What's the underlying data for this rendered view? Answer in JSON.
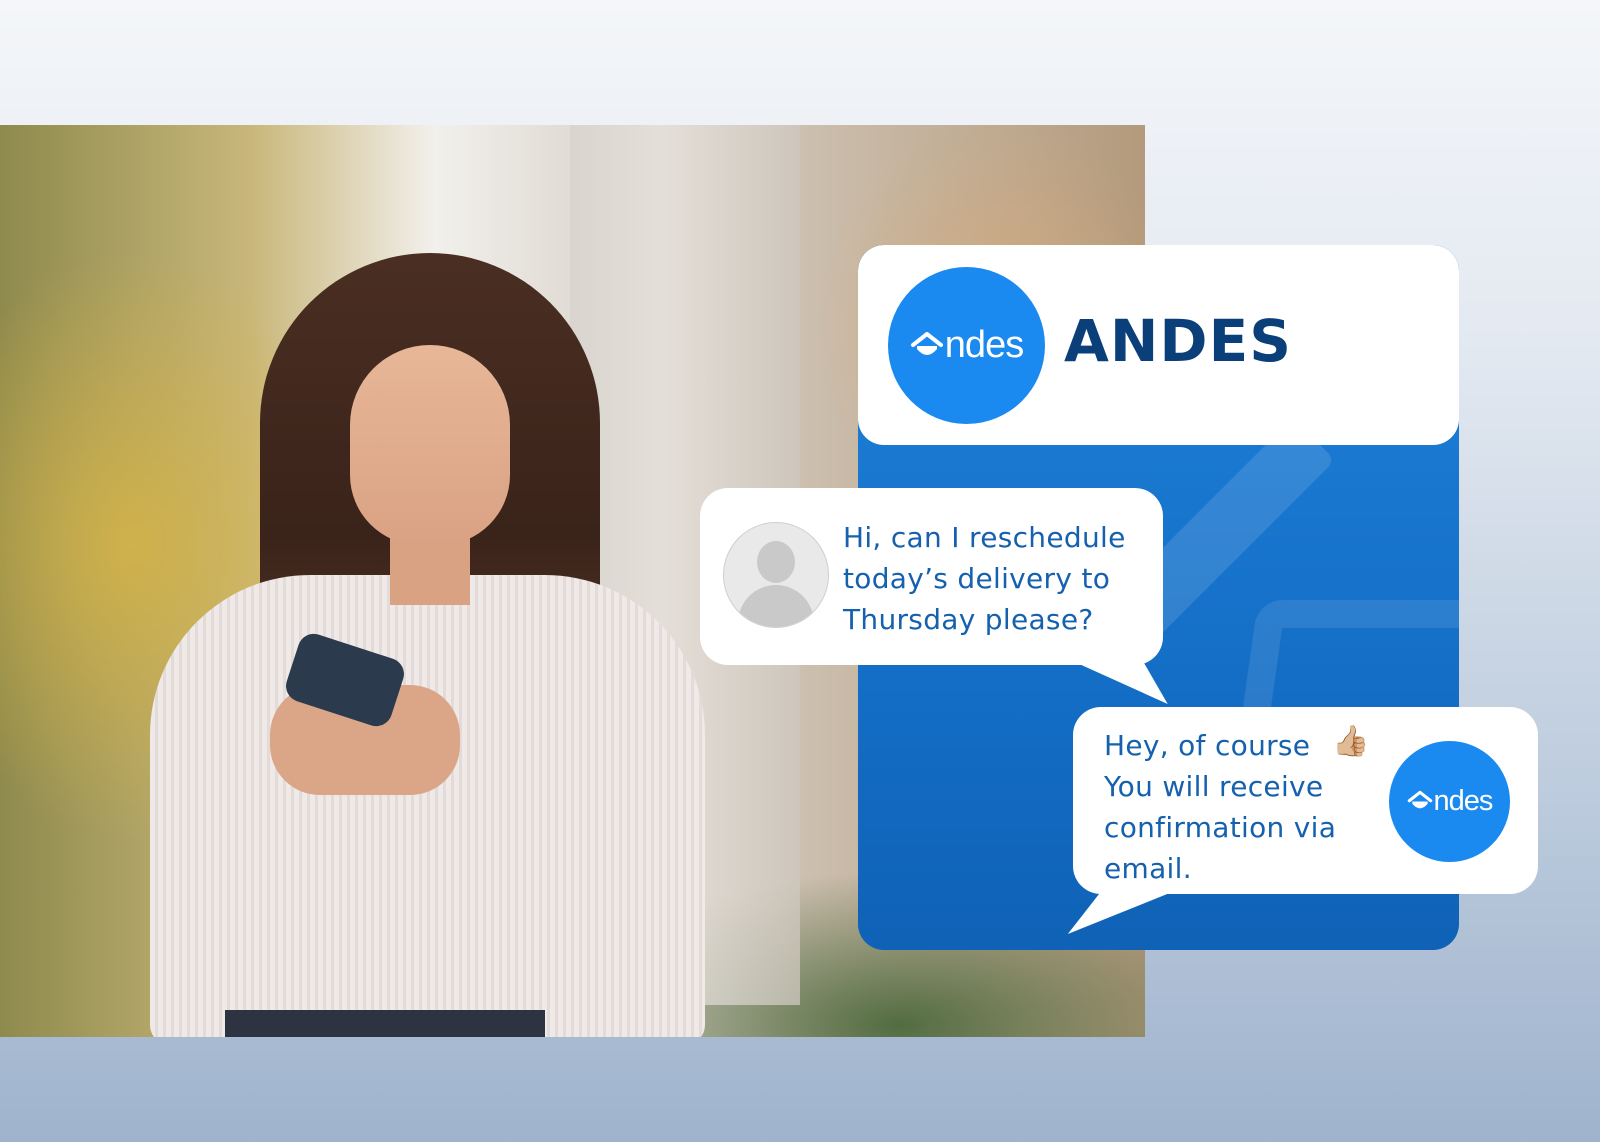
{
  "brand": {
    "name": "ANDES",
    "logo_text": "ndes",
    "accent_color": "#1a8af0",
    "text_color": "#0a3f7a"
  },
  "chat": {
    "user_message": "Hi, can I reschedule\ntoday’s delivery to\nThursday please?",
    "reply_message": "Hey, of course \nYou will receive\nconfirmation via\nemail.",
    "reply_emoji": "👍🏼",
    "message_color": "#1561ad"
  },
  "icons": {
    "avatar": "user-avatar-icon",
    "logo": "house-icon"
  }
}
